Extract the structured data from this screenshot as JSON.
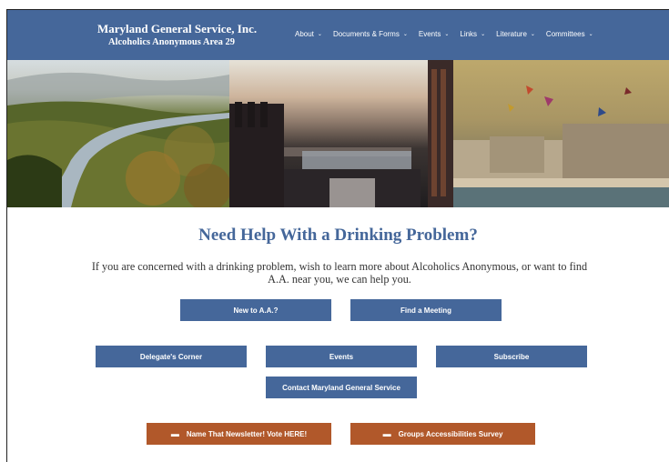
{
  "header": {
    "site_name": "Maryland General Service, Inc.",
    "site_subtitle": "Alcoholics Anonymous Area 29",
    "nav": [
      {
        "label": "About"
      },
      {
        "label": "Documents & Forms"
      },
      {
        "label": "Events"
      },
      {
        "label": "Links"
      },
      {
        "label": "Literature"
      },
      {
        "label": "Committees"
      }
    ],
    "chevron": "⌄"
  },
  "hero": {
    "panels": [
      "river-valley-photo",
      "city-harbor-photo",
      "beach-kites-photo"
    ]
  },
  "main": {
    "title": "Need Help With a Drinking Problem?",
    "intro": "If you are concerned with a drinking problem, wish to learn more about Alcoholics Anonymous, or want to find A.A. near you, we can help you.",
    "buttons": {
      "new_to_aa": "New to A.A.?",
      "find_meeting": "Find a Meeting",
      "delegates_corner": "Delegate's Corner",
      "events": "Events",
      "subscribe": "Subscribe",
      "contact": "Contact Maryland General Service"
    },
    "promo": {
      "newsletter": "Name That Newsletter! Vote HERE!",
      "survey": "Groups Accessibilities Survey",
      "icon_glyph": "▬"
    }
  },
  "colors": {
    "header_blue": "#45679a",
    "button_blue": "#45679a",
    "button_orange": "#b1582a",
    "title_blue": "#45679a"
  }
}
